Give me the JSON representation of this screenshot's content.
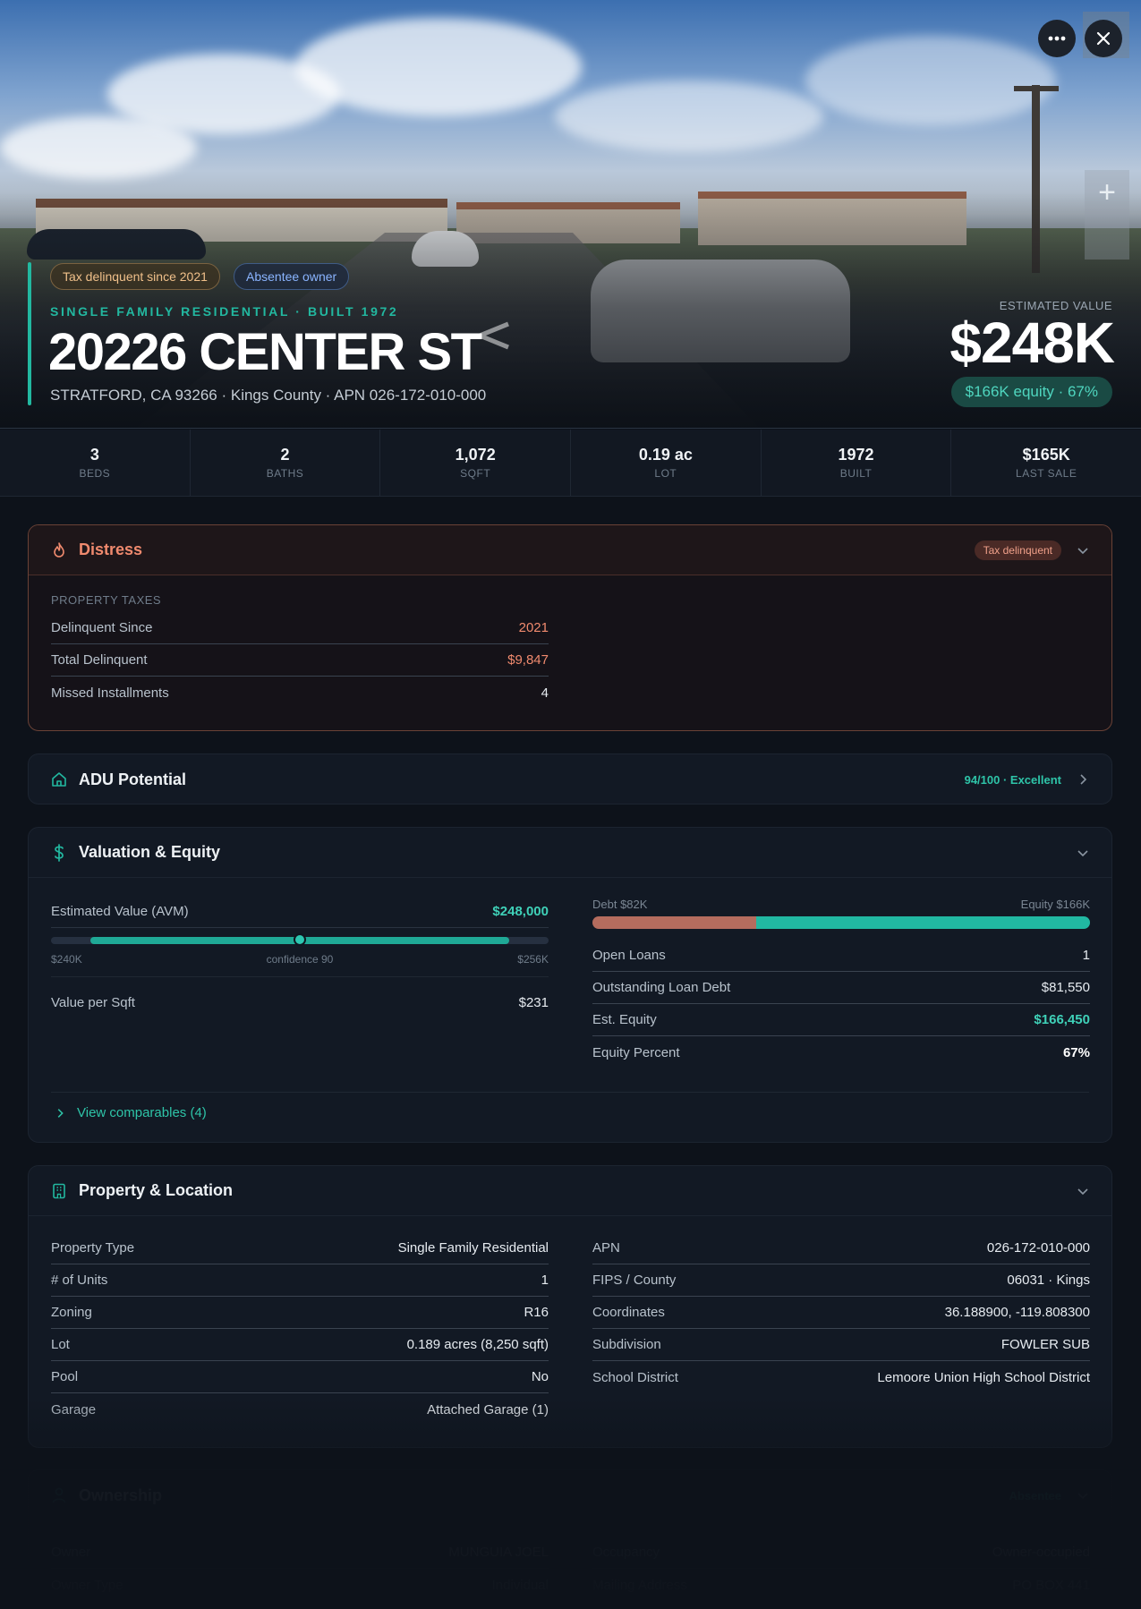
{
  "hero": {
    "badges": {
      "tax": "Tax delinquent since 2021",
      "absentee": "Absentee owner"
    },
    "subtitle": "SINGLE FAMILY RESIDENTIAL · BUILT 1972",
    "address": "20226 CENTER ST",
    "location": "STRATFORD, CA 93266 · Kings County · APN 026-172-010-000",
    "estimated_label": "ESTIMATED VALUE",
    "estimated_value": "$248K",
    "equity_pill": "$166K equity · 67%",
    "icons": {
      "more": "more-icon",
      "close": "close-icon",
      "zoom": "plus-icon"
    }
  },
  "stats": [
    {
      "value": "3",
      "label": "BEDS"
    },
    {
      "value": "2",
      "label": "BATHS"
    },
    {
      "value": "1,072",
      "label": "SQFT"
    },
    {
      "value": "0.19 ac",
      "label": "LOT"
    },
    {
      "value": "1972",
      "label": "BUILT"
    },
    {
      "value": "$165K",
      "label": "LAST SALE"
    }
  ],
  "distress": {
    "title": "Distress",
    "badge": "Tax delinquent",
    "section": "PROPERTY TAXES",
    "rows": [
      {
        "k": "Delinquent Since",
        "v": "2021"
      },
      {
        "k": "Total Delinquent",
        "v": "$9,847"
      },
      {
        "k": "Missed Installments",
        "v": "4"
      }
    ]
  },
  "adu": {
    "title": "ADU Potential",
    "score": "94/100 · Excellent"
  },
  "valuation": {
    "title": "Valuation & Equity",
    "avm_label": "Estimated Value (AVM)",
    "avm_value": "$248,000",
    "range_low": "$240K",
    "confidence": "confidence 90",
    "range_high": "$256K",
    "range_bar": {
      "low_fraction": 0.08,
      "high_fraction": 0.92,
      "point_fraction": 0.5
    },
    "ppsf_label": "Value per Sqft",
    "ppsf_value": "$231",
    "debt_label": "Debt $82K",
    "equity_label": "Equity $166K",
    "debt_fraction": 0.33,
    "rows": [
      {
        "k": "Open Loans",
        "v": "1"
      },
      {
        "k": "Outstanding Loan Debt",
        "v": "$81,550"
      },
      {
        "k": "Est. Equity",
        "v": "$166,450"
      },
      {
        "k": "Equity Percent",
        "v": "67%"
      }
    ],
    "comparables": "View comparables (4)"
  },
  "property": {
    "title": "Property & Location",
    "left": [
      {
        "k": "Property Type",
        "v": "Single Family Residential"
      },
      {
        "k": "# of Units",
        "v": "1"
      },
      {
        "k": "Zoning",
        "v": "R16"
      },
      {
        "k": "Lot",
        "v": "0.189 acres (8,250 sqft)"
      },
      {
        "k": "Pool",
        "v": "No"
      },
      {
        "k": "Garage",
        "v": "Attached Garage (1)"
      }
    ],
    "right": [
      {
        "k": "APN",
        "v": "026-172-010-000"
      },
      {
        "k": "FIPS / County",
        "v": "06031 · Kings"
      },
      {
        "k": "Coordinates",
        "v": "36.188900, -119.808300"
      },
      {
        "k": "Subdivision",
        "v": "FOWLER SUB"
      },
      {
        "k": "School District",
        "v": "Lemoore Union High School District"
      }
    ]
  },
  "ownership": {
    "title": "Ownership",
    "badge": "Absentee",
    "left": [
      {
        "k": "Owner",
        "v": "MUNGUIA JOEL"
      },
      {
        "k": "Owner Type",
        "v": "Individual"
      }
    ],
    "right": [
      {
        "k": "Occupancy",
        "v": "Owner-occupied"
      },
      {
        "k": "Mailing Address",
        "v": "PO BOX 441"
      }
    ]
  },
  "colors": {
    "accent": "#22b8a0",
    "distress": "#f08a6e",
    "absentee": "#8ab4ff"
  }
}
